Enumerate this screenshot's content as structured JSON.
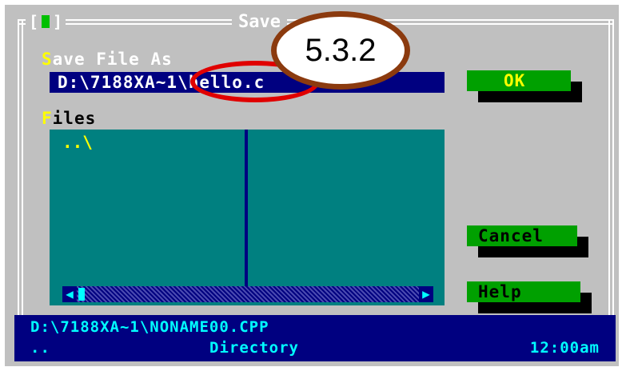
{
  "window": {
    "title": "Save",
    "close_box": "[ ]"
  },
  "save_as": {
    "label_hot": "S",
    "label_rest": "ave File As",
    "value": "D:\\7188XA~1\\hello.c"
  },
  "files": {
    "label_hot": "F",
    "label_rest": "iles",
    "items": [
      "..\\"
    ]
  },
  "buttons": {
    "ok": {
      "label": "OK"
    },
    "cancel": {
      "label_hot": "C",
      "label_rest": "ancel"
    },
    "help": {
      "label_hot": "H",
      "label_rest": "elp"
    }
  },
  "status": {
    "path": "D:\\7188XA~1\\NONAME00.CPP",
    "dots": "..",
    "kind": "Directory",
    "time": "12:00am"
  },
  "annotation": {
    "badge": "5.3.2"
  },
  "colors": {
    "dialog": "#c0c0c0",
    "navy": "#000080",
    "teal": "#008080",
    "button_green": "#00a000",
    "hotkey_yellow": "#ffff00",
    "badge_border": "#8b3a0e",
    "highlight_ring": "#e00000"
  }
}
